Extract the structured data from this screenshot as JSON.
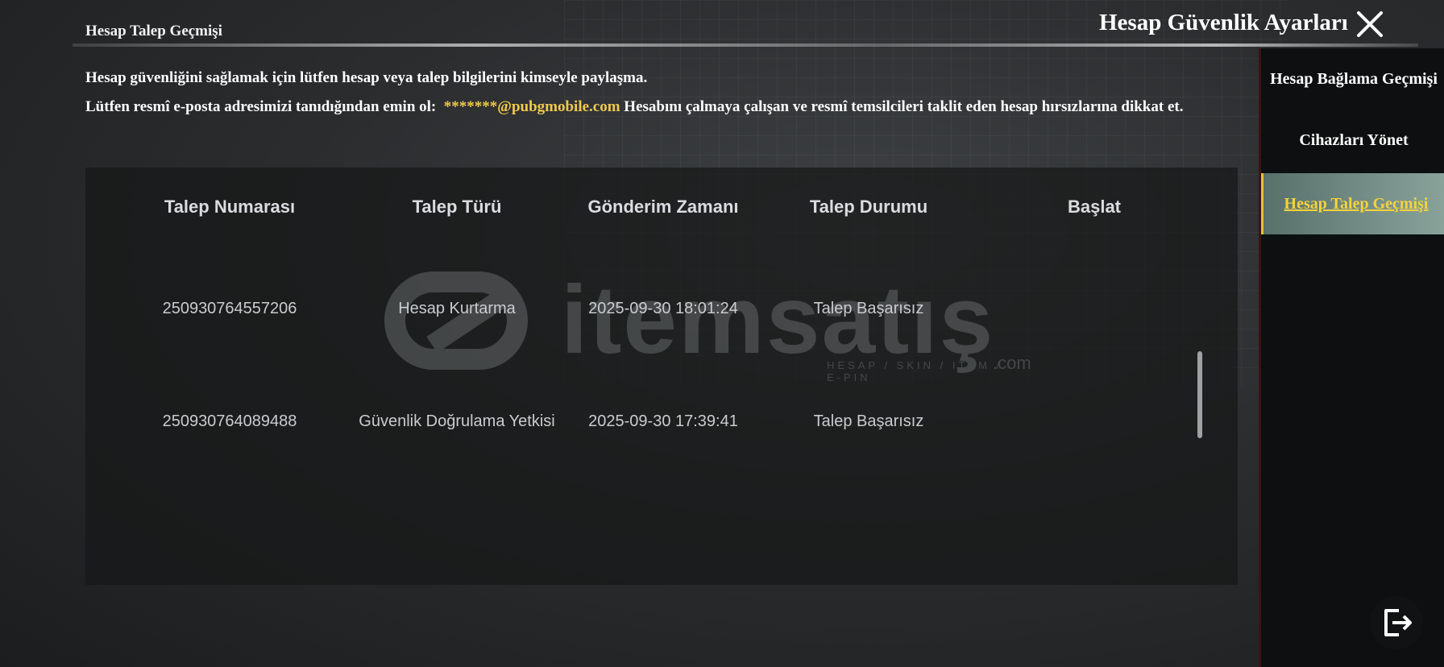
{
  "header": {
    "page_title": "Hesap Talep Geçmişi",
    "window_title": "Hesap Güvenlik Ayarları"
  },
  "notice": {
    "line1": "Hesap güvenliğini sağlamak için lütfen hesap veya talep bilgilerini kimseyle paylaşma.",
    "line2_prefix": "Lütfen resmî e-posta adresimizi tanıdığından emin ol:",
    "email": "*******@pubgmobile.com",
    "line2_suffix": "Hesabını çalmaya çalışan ve resmî temsilcileri taklit eden hesap hırsızlarına dikkat et."
  },
  "table": {
    "columns": [
      "Talep Numarası",
      "Talep Türü",
      "Gönderim Zamanı",
      "Talep Durumu",
      "Başlat"
    ],
    "rows": [
      {
        "number": "250930764557206",
        "type": "Hesap Kurtarma",
        "time": "2025-09-30 18:01:24",
        "status": "Talep Başarısız",
        "start": ""
      },
      {
        "number": "250930764089488",
        "type": "Güvenlik Doğrulama Yetkisi",
        "time": "2025-09-30 17:39:41",
        "status": "Talep Başarısız",
        "start": ""
      }
    ]
  },
  "watermark": {
    "brand": "itemsatış",
    "tagline": "HESAP / SKIN / ITEM / E-PIN",
    "suffix": ".com"
  },
  "sidebar": {
    "items": [
      {
        "label": "Hesap Bağlama Geçmişi",
        "active": false
      },
      {
        "label": "Cihazları Yönet",
        "active": false
      },
      {
        "label": "Hesap Talep Geçmişi",
        "active": true
      }
    ]
  },
  "icons": {
    "close": "close-icon",
    "exit": "exit-icon"
  },
  "colors": {
    "accent": "#f2c94c",
    "active_tab_bg": "#7a938c",
    "sidebar_bg": "#0e0f10"
  }
}
